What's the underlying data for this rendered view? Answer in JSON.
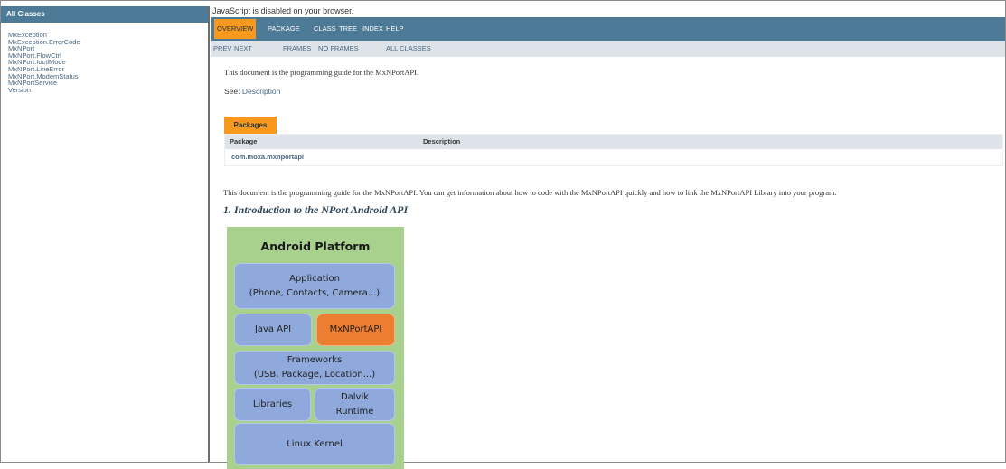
{
  "left": {
    "header": "All Classes",
    "classes": [
      "MxException",
      "MxException.ErrorCode",
      "MxNPort",
      "MxNPort.FlowCtrl",
      "MxNPort.IoctlMode",
      "MxNPort.LineError",
      "MxNPort.ModemStatus",
      "MxNPortService",
      "Version"
    ]
  },
  "js_message": "JavaScript is disabled on your browser.",
  "topnav": [
    "OVERVIEW",
    "PACKAGE",
    "CLASS",
    "TREE",
    "INDEX",
    "HELP"
  ],
  "subnav": {
    "prev": "PREV",
    "next": "NEXT",
    "frames": "FRAMES",
    "no_frames": "NO FRAMES",
    "all_classes": "ALL CLASSES"
  },
  "intro_text": "This document is the programming guide for the MxNPortAPI.",
  "see": {
    "label": "See:",
    "link": "Description"
  },
  "packages": {
    "tab": "Packages",
    "headers": [
      "Package",
      "Description"
    ],
    "rows": [
      {
        "name": "com.moxa.mxnportapi",
        "description": ""
      }
    ]
  },
  "body_text": "This document is the programming guide for the MxNPortAPI. You can get information about how to code with the MxNPortAPI quickly and how to link the MxNPortAPI Library into your program.",
  "intro_heading": "1. Introduction to the NPort Android API",
  "diagram": {
    "title": "Android Platform",
    "application": [
      "Application",
      "(Phone, Contacts, Camera...)"
    ],
    "java_api": "Java API",
    "mxnportapi": "MxNPortAPI",
    "frameworks": [
      "Frameworks",
      "(USB, Package, Location...)"
    ],
    "libraries": "Libraries",
    "dalvik": [
      "Dalvik",
      "Runtime"
    ],
    "linux": "Linux Kernel"
  }
}
